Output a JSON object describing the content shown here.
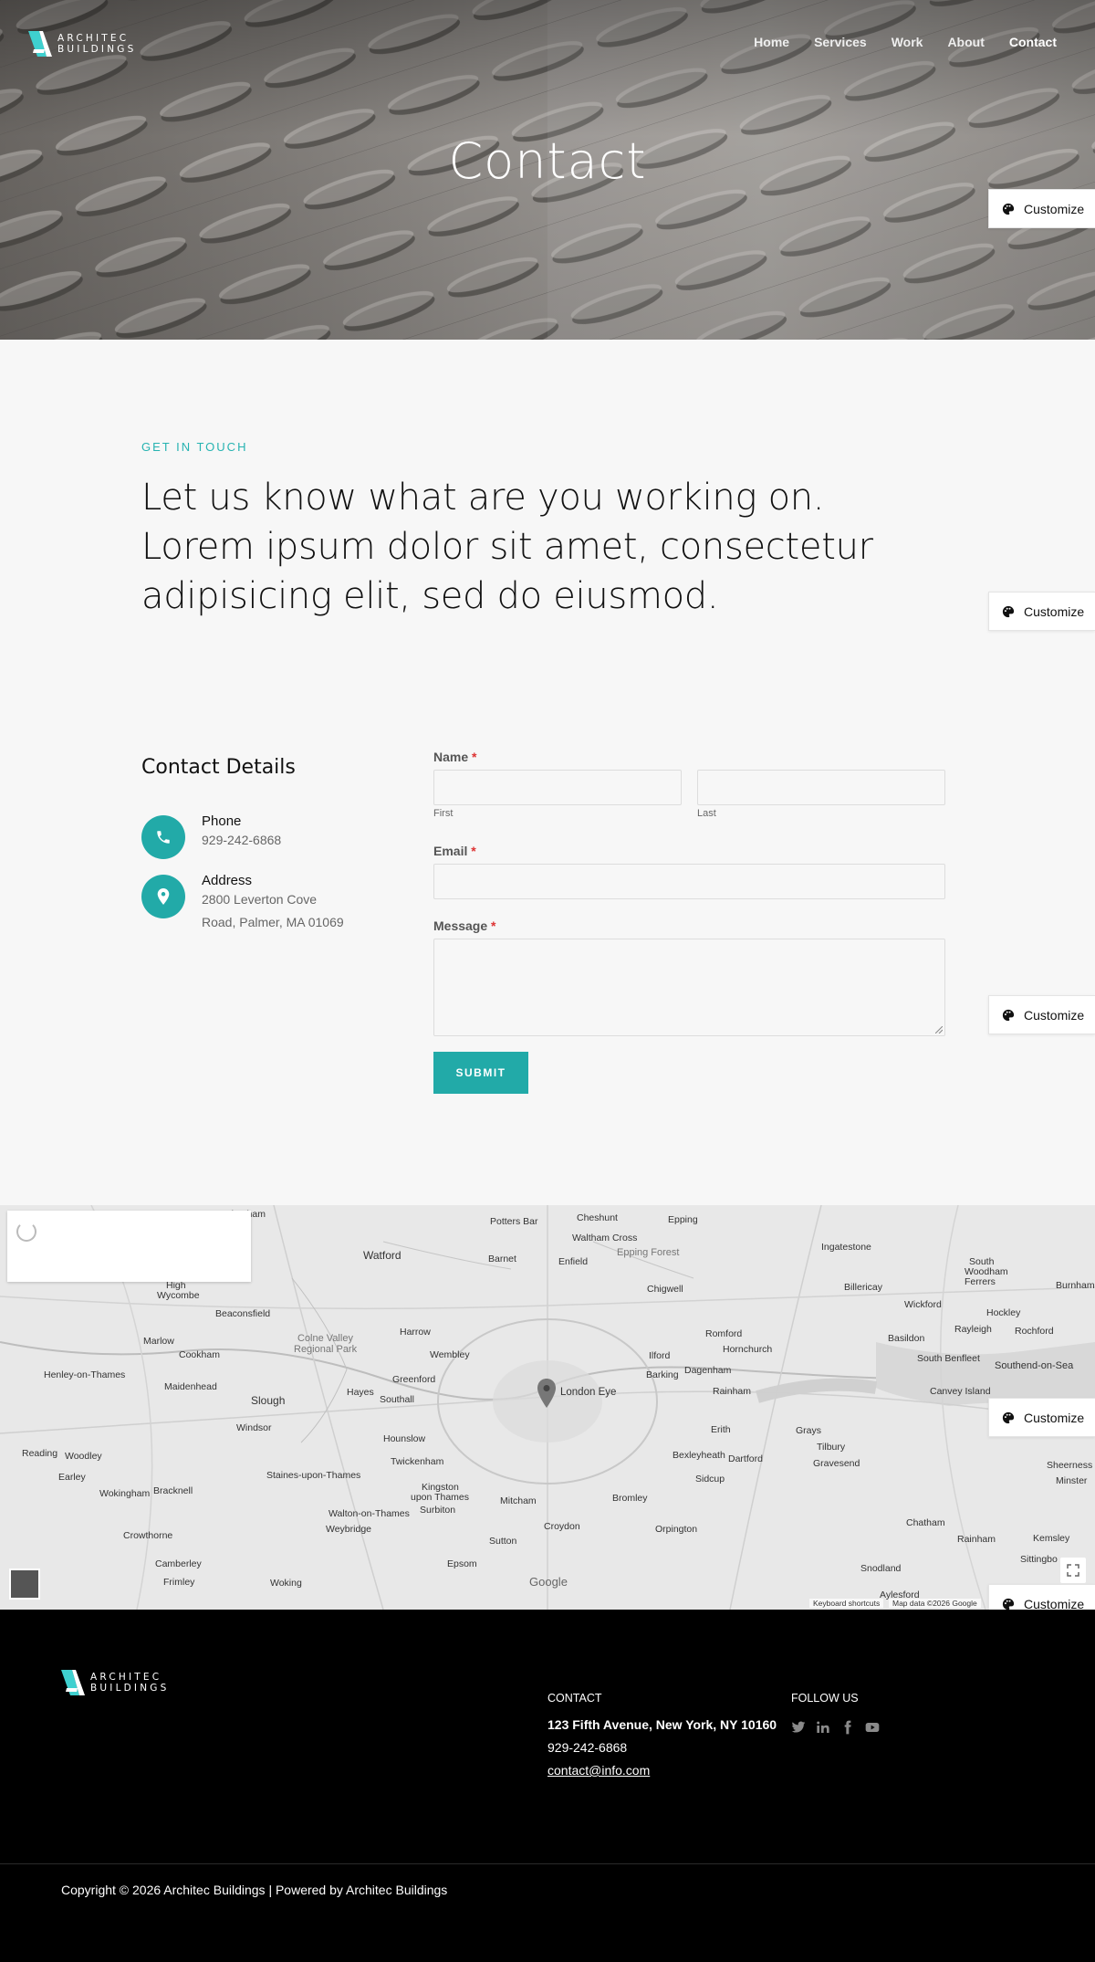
{
  "header": {
    "logo": {
      "line1": "ARCHITEC",
      "line2": "BUILDINGS"
    },
    "nav": [
      {
        "label": "Home",
        "active": false
      },
      {
        "label": "Services",
        "active": false
      },
      {
        "label": "Work",
        "active": false
      },
      {
        "label": "About",
        "active": false
      },
      {
        "label": "Contact",
        "active": true
      }
    ],
    "title": "Contact"
  },
  "customize_label": "Customize",
  "intro": {
    "eyebrow": "GET IN TOUCH",
    "heading_line1": "Let us know what are you working on.",
    "heading_line2": "Lorem ipsum dolor sit amet, consectetur",
    "heading_line3": "adipisicing elit, sed do eiusmod."
  },
  "contact_details": {
    "title": "Contact Details",
    "phone_label": "Phone",
    "phone_value": "929-242-6868",
    "address_label": "Address",
    "address_line1": "2800 Leverton Cove",
    "address_line2": "Road, Palmer, MA 01069"
  },
  "form": {
    "name_label": "Name",
    "required_mark": "*",
    "first_sub": "First",
    "last_sub": "Last",
    "email_label": "Email",
    "message_label": "Message",
    "submit_label": "SUBMIT"
  },
  "map": {
    "labels": {
      "chesham": "Chesham",
      "potters_bar": "Potters Bar",
      "cheshunt": "Cheshunt",
      "epping": "Epping",
      "watford": "Watford",
      "barnet": "Barnet",
      "enfield": "Enfield",
      "waltham_cross": "Waltham Cross",
      "epping_forest": "Epping Forest",
      "ingatestone": "Ingatestone",
      "south_woodham": "South",
      "south_woodham2": "Woodham",
      "south_woodham3": "Ferrers",
      "burnham": "Burnham",
      "high_wycombe": "High",
      "high_wycombe2": "Wycombe",
      "beaconsfield": "Beaconsfield",
      "billericay": "Billericay",
      "chigwell": "Chigwell",
      "wickford": "Wickford",
      "hockley": "Hockley",
      "marlow": "Marlow",
      "colne_valley": "Colne Valley",
      "colne_valley2": "Regional Park",
      "harrow": "Harrow",
      "romford": "Romford",
      "basildon": "Basildon",
      "rayleigh": "Rayleigh",
      "rochford": "Rochford",
      "cookham": "Cookham",
      "wembley": "Wembley",
      "ilford": "Ilford",
      "hornchurch": "Hornchurch",
      "south_benfleet": "South Benfleet",
      "southend": "Southend-on-Sea",
      "henley": "Henley-on-Thames",
      "maidenhead": "Maidenhead",
      "greenford": "Greenford",
      "barking": "Barking",
      "dagenham": "Dagenham",
      "slough": "Slough",
      "hayes": "Hayes",
      "southall": "Southall",
      "london_eye": "London Eye",
      "rainham": "Rainham",
      "canvey": "Canvey Island",
      "windsor": "Windsor",
      "hounslow": "Hounslow",
      "erith": "Erith",
      "grays": "Grays",
      "reading": "Reading",
      "woodley": "Woodley",
      "twickenham": "Twickenham",
      "bexleyheath": "Bexleyheath",
      "dartford": "Dartford",
      "tilbury": "Tilbury",
      "gravesend": "Gravesend",
      "sheerness": "Sheerness",
      "minster": "Minster",
      "earley": "Earley",
      "staines": "Staines-upon-Thames",
      "kingston": "Kingston",
      "kingston2": "upon Thames",
      "surbiton": "Surbiton",
      "sidcup": "Sidcup",
      "wokingham": "Wokingham",
      "bracknell": "Bracknell",
      "walton": "Walton-on-Thames",
      "mitcham": "Mitcham",
      "bromley": "Bromley",
      "chatham": "Chatham",
      "crowthorne": "Crowthorne",
      "weybridge": "Weybridge",
      "croydon": "Croydon",
      "orpington": "Orpington",
      "rainham_kent": "Rainham",
      "kemsley": "Kemsley",
      "sutton": "Sutton",
      "camberley": "Camberley",
      "epsom": "Epsom",
      "snodland": "Snodland",
      "sittingbourne": "Sittingbo",
      "frimley": "Frimley",
      "woking": "Woking",
      "aylesford": "Aylesford"
    },
    "google": "Google",
    "shortcuts": "Keyboard shortcuts",
    "attribution": "Map data ©2026 Google"
  },
  "footer": {
    "logo": {
      "line1": "ARCHITEC",
      "line2": "BUILDINGS"
    },
    "contact_title": "CONTACT",
    "address": "123 Fifth Avenue, New York, NY 10160",
    "phone": "929-242-6868",
    "email": "contact@info.com",
    "follow_title": "FOLLOW US",
    "social_icons": [
      "twitter-icon",
      "linkedin-icon",
      "facebook-icon",
      "youtube-icon"
    ],
    "copyright": "Copyright © 2026 Architec Buildings | Powered by Architec Buildings"
  },
  "colors": {
    "accent": "#22aaa8",
    "footer_bg": "#000000",
    "page_bg": "#f7f7f7"
  }
}
